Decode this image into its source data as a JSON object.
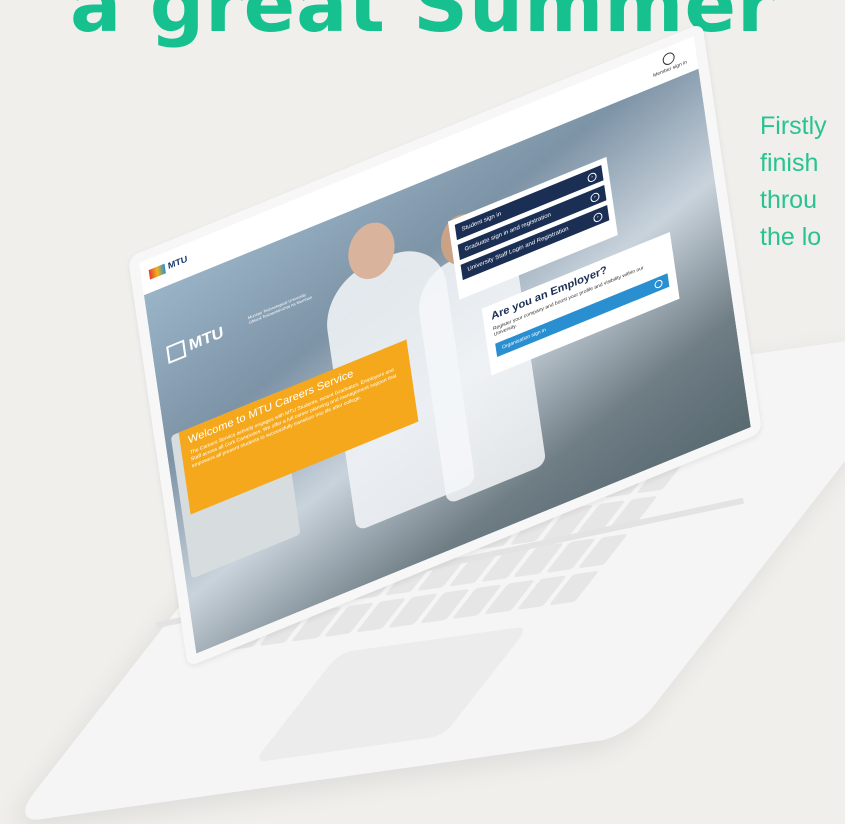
{
  "headline": "a great Summer",
  "side_text": [
    "Firstly",
    "finish",
    "throu",
    "the lo"
  ],
  "site": {
    "brand_small": "MTU",
    "member_label": "Member sign in",
    "mtu_logo": "MTU",
    "mtu_logo_sub": "Munster Technological University Ollscoil Teicneolaíochta na Mumhan",
    "welcome_title": "Welcome to MTU Careers Service",
    "welcome_text": "The Careers Service actively engages with MTU Students, recent Graduates, Employers and Staff across all Cork Campuses. We offer a full career planning and management support that empowers all present students to successfully transition into life after college.",
    "login_buttons": [
      {
        "label": "Student sign in"
      },
      {
        "label": "Graduate sign in and registration"
      },
      {
        "label": "University Staff Login and Registration"
      }
    ],
    "employer_title": "Are you an Employer?",
    "employer_text": "Register your company and boost your profile and visibility within our University.",
    "org_button": "Organisation sign in"
  }
}
